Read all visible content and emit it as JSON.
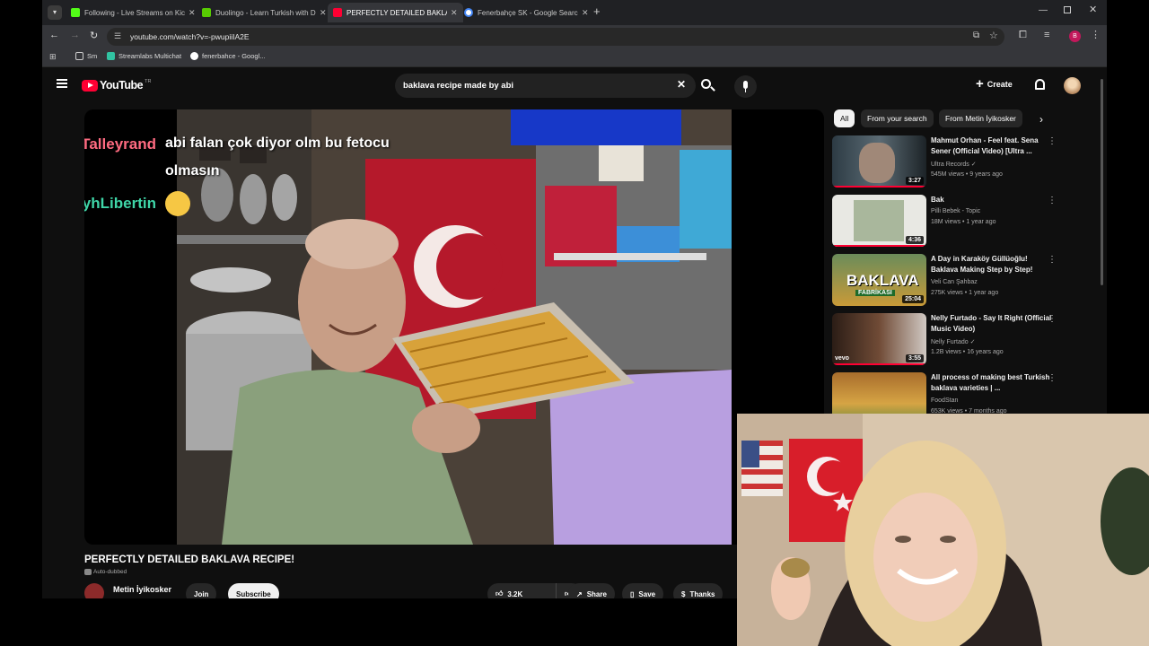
{
  "browser": {
    "tabs": [
      {
        "label": "Following - Live Streams on Kick",
        "favicon_color": "#53fc18"
      },
      {
        "label": "Duolingo - Learn Turkish with Duolingo",
        "favicon_color": "#58cc02"
      },
      {
        "label": "PERFECTLY DETAILED BAKLAVA RECIPE!",
        "favicon_color": "#ff0033"
      },
      {
        "label": "Fenerbahçe SK - Google Search",
        "favicon_color": "#4285f4"
      }
    ],
    "url": "youtube.com/watch?v=-pwupiiIA2E",
    "profile_initial": "B",
    "bookmarks": [
      {
        "label": "Sm"
      },
      {
        "label": "Streamlabs Multichat"
      },
      {
        "label": "fenerbahce - Googl..."
      }
    ]
  },
  "youtube": {
    "logo_text": "YouTube",
    "country_code": "TR",
    "search_query": "baklava recipe made by abi",
    "create_label": "Create",
    "video": {
      "title": "PERFECTLY DETAILED BAKLAVA RECIPE!",
      "auto_dubbed": "Auto-dubbed",
      "channel": "Metin İyikosker",
      "join_label": "Join",
      "subscribe_label": "Subscribe",
      "likes": "3.2K",
      "share_label": "Share",
      "save_label": "Save",
      "thanks_label": "Thanks"
    },
    "chips": [
      "All",
      "From your search",
      "From Metin İyikosker"
    ],
    "recommendations": [
      {
        "title": "Mahmut Orhan - Feel feat. Sena Sener (Official Video) [Ultra ...",
        "channel": "Ultra Records",
        "verified": true,
        "meta": "545M views • 9 years ago",
        "duration": "3:27"
      },
      {
        "title": "Bak",
        "channel": "Pilli Bebek - Topic",
        "verified": false,
        "meta": "18M views • 1 year ago",
        "duration": "4:36"
      },
      {
        "title": "A Day in Karaköy Güllüoğlu! Baklava Making Step by Step!",
        "channel": "Veli Can Şahbaz",
        "verified": false,
        "meta": "275K views • 1 year ago",
        "duration": "25:04",
        "thumb_text": "BAKLAVA",
        "thumb_subtext": "FABRİKASI"
      },
      {
        "title": "Nelly Furtado - Say It Right (Official Music Video)",
        "channel": "Nelly Furtado",
        "verified": true,
        "meta": "1.2B views • 16 years ago",
        "duration": "3:55",
        "thumb_text": "vevo"
      },
      {
        "title": "All process of making best Turkish baklava varieties | ...",
        "channel": "FoodStan",
        "verified": false,
        "meta": "653K views • 7 months ago",
        "duration": ""
      }
    ]
  },
  "chat_overlay": [
    {
      "user": "wTalleyrand",
      "color": "#ff6b81",
      "message": "abi falan çok diyor olm bu fetocu olmasın"
    },
    {
      "user": "SeyhLibertin",
      "color": "#3fd6a8",
      "message": ""
    }
  ],
  "colors": {
    "yt_red": "#ff0033",
    "bg": "#0f0f0f",
    "turkish_red": "#d81e2a"
  }
}
